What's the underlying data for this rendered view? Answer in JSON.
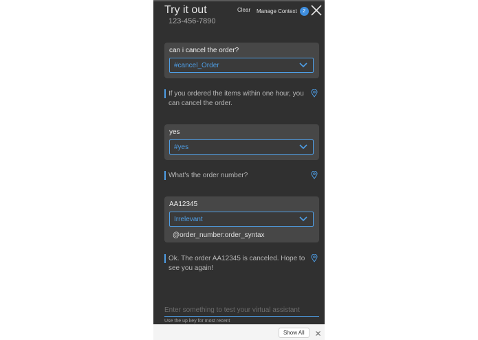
{
  "header": {
    "title": "Try it out",
    "phone": "123-456-7890",
    "clear_label": "Clear",
    "manage_context_label": "Manage Context",
    "context_count": "2"
  },
  "conversation": [
    {
      "type": "user",
      "text": "can i cancel the order?",
      "intent": "#cancel_Order"
    },
    {
      "type": "bot",
      "text": "If you ordered the items within one hour, you can cancel the order."
    },
    {
      "type": "user",
      "text": "yes",
      "intent": "#yes"
    },
    {
      "type": "bot",
      "text": "What's the order number?"
    },
    {
      "type": "user",
      "text": "AA12345",
      "intent": "Irrelevant",
      "entity": "@order_number:order_syntax"
    },
    {
      "type": "bot",
      "text": "Ok. The order AA12345 is canceled. Hope to see you again!"
    }
  ],
  "input": {
    "placeholder": "Enter something to test your virtual assistant",
    "hint": "Use the up key for most recent"
  },
  "footer": {
    "show_all_label": "Show All"
  },
  "colors": {
    "panel_bg": "#303030",
    "card_bg": "#474747",
    "accent": "#4e9ee6",
    "badge": "#3e8ddd"
  }
}
